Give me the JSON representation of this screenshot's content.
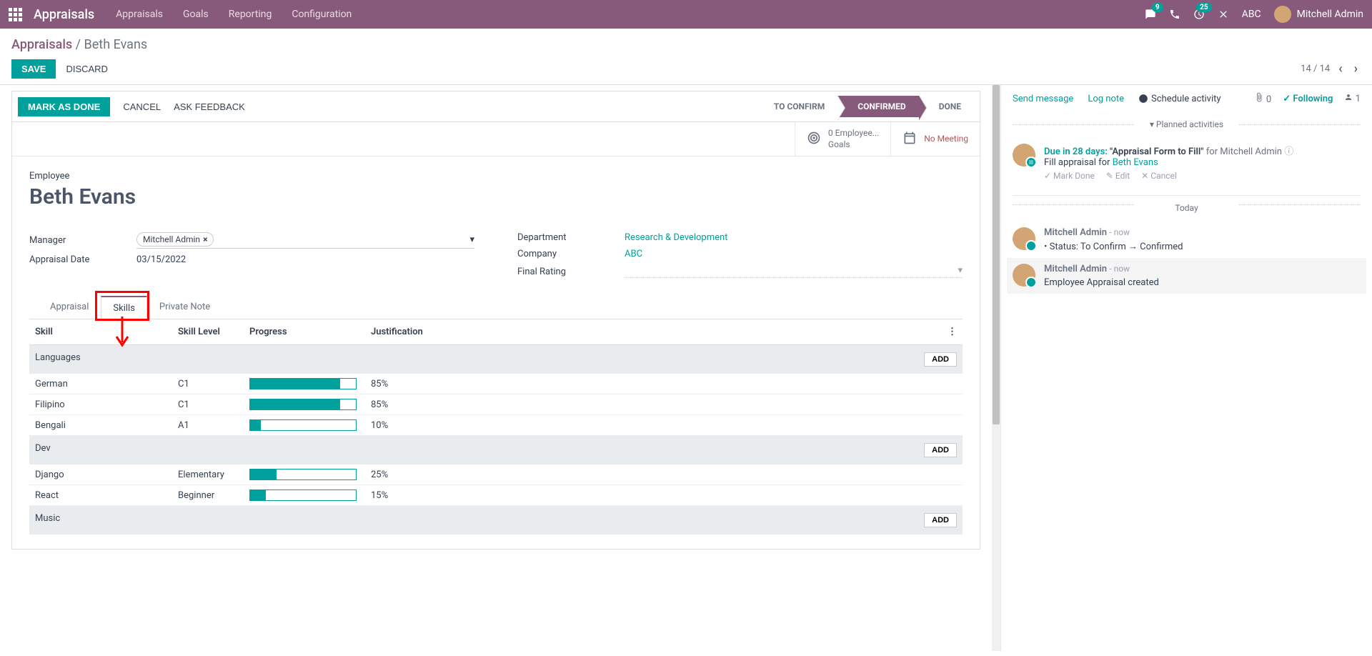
{
  "navbar": {
    "brand": "Appraisals",
    "links": [
      "Appraisals",
      "Goals",
      "Reporting",
      "Configuration"
    ],
    "chat_badge": "9",
    "activity_badge": "25",
    "company": "ABC",
    "user": "Mitchell Admin"
  },
  "breadcrumb": {
    "root": "Appraisals",
    "current": "Beth Evans"
  },
  "actions": {
    "save": "SAVE",
    "discard": "DISCARD",
    "pager": "14 / 14"
  },
  "statusbar": {
    "mark_done": "MARK AS DONE",
    "cancel": "CANCEL",
    "ask_feedback": "ASK FEEDBACK",
    "steps": [
      "TO CONFIRM",
      "CONFIRMED",
      "DONE"
    ],
    "active_step": 1
  },
  "stat_buttons": {
    "goals": {
      "line1": "0 Employee...",
      "line2": "Goals"
    },
    "meeting": "No Meeting"
  },
  "employee": {
    "label": "Employee",
    "name": "Beth Evans"
  },
  "fields": {
    "manager_label": "Manager",
    "manager_value": "Mitchell Admin",
    "appraisal_date_label": "Appraisal Date",
    "appraisal_date_value": "03/15/2022",
    "department_label": "Department",
    "department_value": "Research & Development",
    "company_label": "Company",
    "company_value": "ABC",
    "final_rating_label": "Final Rating",
    "final_rating_value": ""
  },
  "tabs": [
    "Appraisal",
    "Skills",
    "Private Note"
  ],
  "skills_table": {
    "headers": [
      "Skill",
      "Skill Level",
      "Progress",
      "Justification"
    ],
    "add_label": "ADD",
    "groups": [
      {
        "name": "Languages",
        "rows": [
          {
            "skill": "German",
            "level": "C1",
            "progress": 85,
            "progress_label": "85%"
          },
          {
            "skill": "Filipino",
            "level": "C1",
            "progress": 85,
            "progress_label": "85%"
          },
          {
            "skill": "Bengali",
            "level": "A1",
            "progress": 10,
            "progress_label": "10%"
          }
        ]
      },
      {
        "name": "Dev",
        "rows": [
          {
            "skill": "Django",
            "level": "Elementary",
            "progress": 25,
            "progress_label": "25%"
          },
          {
            "skill": "React",
            "level": "Beginner",
            "progress": 15,
            "progress_label": "15%"
          }
        ]
      },
      {
        "name": "Music",
        "rows": []
      }
    ]
  },
  "chatter": {
    "send_message": "Send message",
    "log_note": "Log note",
    "schedule_activity": "Schedule activity",
    "attachments": "0",
    "following": "Following",
    "followers": "1",
    "planned_activities_title": "Planned activities",
    "activity": {
      "due": "Due in 28 days:",
      "title": "\"Appraisal Form to Fill\"",
      "for": "for Mitchell Admin",
      "desc_prefix": "Fill appraisal for ",
      "desc_link": "Beth Evans",
      "mark_done": "Mark Done",
      "edit": "Edit",
      "cancel": "Cancel"
    },
    "today_title": "Today",
    "logs": [
      {
        "author": "Mitchell Admin",
        "time": "- now",
        "content": "Status: To Confirm → Confirmed",
        "is_status": true
      },
      {
        "author": "Mitchell Admin",
        "time": "- now",
        "content": "Employee Appraisal created",
        "is_status": false
      }
    ]
  }
}
